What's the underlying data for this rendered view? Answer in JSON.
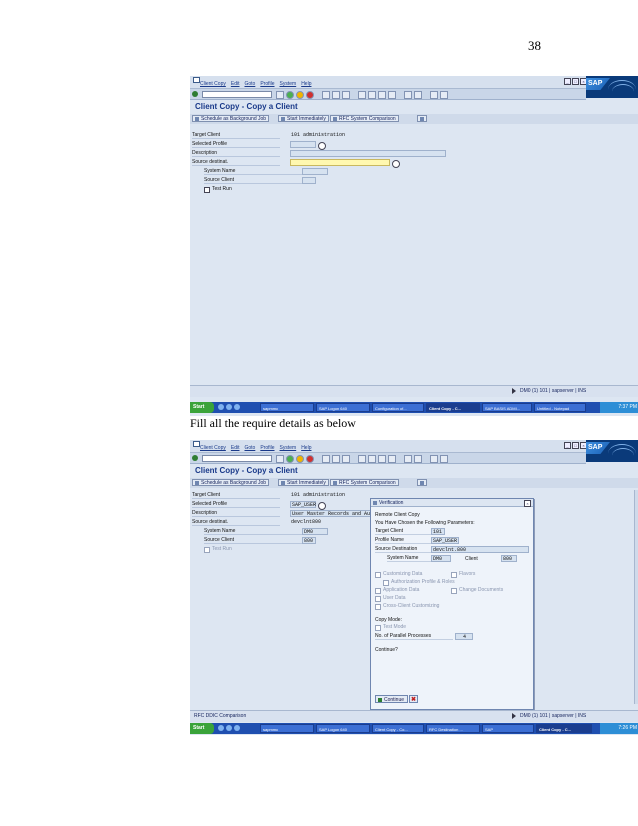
{
  "page_number": "38",
  "caption": "Fill all the require details as below",
  "shot1": {
    "menu": [
      "Client Copy",
      "Edit",
      "Goto",
      "Profile",
      "System",
      "Help"
    ],
    "logo": "SAP",
    "title": "Client Copy - Copy a Client",
    "app_buttons": [
      "Schedule as Background Job",
      "Start Immediately",
      "RFC System Comparison"
    ],
    "fields": {
      "target_client_label": "Target Client",
      "target_client_value": "101 administration",
      "selected_profile_label": "Selected Profile",
      "description_label": "Description",
      "source_dest_label": "Source destinat.",
      "system_name_label": "System Name",
      "source_client_label": "Source Client",
      "test_run_label": "Test Run"
    },
    "status": {
      "message": "",
      "system": "DM0 (1) 101 | sapserver | INS"
    },
    "taskbar": {
      "start": "Start",
      "tasks": [
        "sapmmc",
        "SAP Logon 640",
        "Configuration of...",
        "Client Copy - C...",
        "SAP BASIS ADMI...",
        "Untitled - Notepad"
      ],
      "active_index": 3,
      "clock": "7:37 PM"
    }
  },
  "shot2": {
    "menu": [
      "Client Copy",
      "Edit",
      "Goto",
      "Profile",
      "System",
      "Help"
    ],
    "logo": "SAP",
    "title": "Client Copy - Copy a Client",
    "app_buttons": [
      "Schedule as Background Job",
      "Start Immediately",
      "RFC System Comparison"
    ],
    "fields": {
      "target_client_label": "Target Client",
      "target_client_value": "101 administration",
      "selected_profile_label": "Selected Profile",
      "selected_profile_value": "SAP_USER",
      "description_label": "Description",
      "description_value": "User Master Records and Authorization Profiles",
      "source_dest_label": "Source destinat.",
      "source_dest_value": "devclnt800",
      "system_name_label": "System Name",
      "system_name_value": "DM0",
      "source_client_label": "Source Client",
      "source_client_value": "800",
      "test_run_label": "Test Run"
    },
    "dialog": {
      "title": "Verification",
      "heading1": "Remote Client Copy",
      "heading2": "You Have Chosen the Following Parameters:",
      "target_client_label": "Target Client",
      "target_client_value": "101",
      "profile_name_label": "Profile Name",
      "profile_name_value": "SAP_USER",
      "source_dest_label": "Source Destination",
      "source_dest_value": "devclnt.800",
      "system_name_label": "System Name",
      "system_name_value": "DM0",
      "client_label": "Client",
      "client_value": "800",
      "customizing": "Customizing Data",
      "flavors": "Flavors",
      "auth_profile": "Authorization Profile & Roles",
      "application_data": "Application Data",
      "change_documents": "Change Documents",
      "user_data": "User Data",
      "cross_client": "Cross-Client Customizing",
      "copy_mode": "Copy Mode:",
      "test_mode": "Test Mode",
      "parallel_label": "No. of Parallel Processes",
      "parallel_value": "4",
      "continue_q": "Continue?",
      "continue_btn": "Continue"
    },
    "status": {
      "message": "RFC DDIC Comparison",
      "system": "DM0 (1) 101 | sapserver | INS"
    },
    "taskbar": {
      "start": "Start",
      "tasks": [
        "sapmmc",
        "SAP Logon 640",
        "Client Copy - Co...",
        "RFC Destination ...",
        "SAP",
        "Client Copy - C..."
      ],
      "active_index": 5,
      "clock": "7:26 PM"
    }
  }
}
